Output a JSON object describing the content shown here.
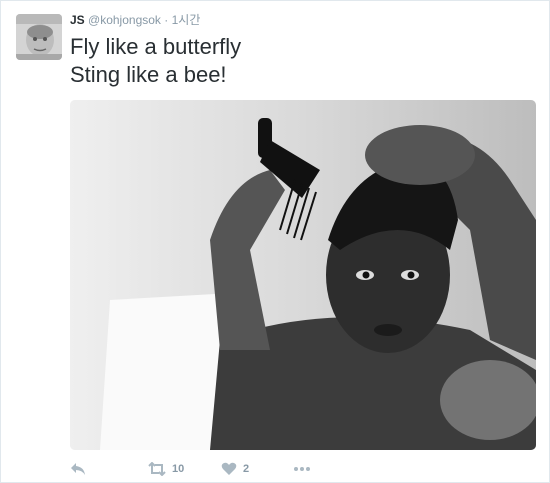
{
  "tweet": {
    "author": {
      "name": "JS",
      "handle": "@kohjongsok",
      "separator": "·",
      "time": "1시간"
    },
    "text_lines": [
      "Fly like a butterfly",
      "Sting like a bee!"
    ],
    "actions": {
      "retweet_count": "10",
      "like_count": "2"
    }
  },
  "icons": {
    "reply": "reply-icon",
    "retweet": "retweet-icon",
    "like": "heart-icon",
    "more": "more-icon"
  },
  "colors": {
    "action_icon": "#aab8c2",
    "text": "#292f33",
    "meta": "#8899a6"
  }
}
